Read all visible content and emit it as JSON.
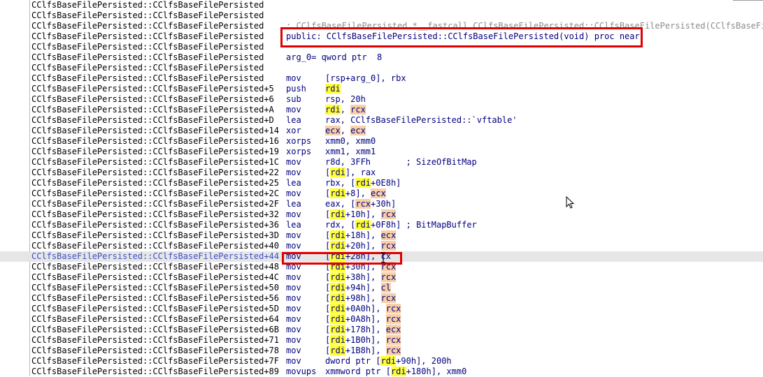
{
  "disassembly": {
    "rows": [
      {
        "addr": "CClfsBaseFilePersisted::CClfsBaseFilePersisted",
        "text": ""
      },
      {
        "addr": "CClfsBaseFilePersisted::CClfsBaseFilePersisted",
        "text": ""
      },
      {
        "addr": "CClfsBaseFilePersisted::CClfsBaseFilePersisted",
        "text": "; CClfsBaseFilePersisted *__fastcall CClfsBaseFilePersisted::CClfsBaseFilePersisted(CClfsBaseFileP",
        "kind": "proto"
      },
      {
        "addr": "CClfsBaseFilePersisted::CClfsBaseFilePersisted",
        "text": "public: CClfsBaseFilePersisted::CClfsBaseFilePersisted(void) proc near"
      },
      {
        "addr": "CClfsBaseFilePersisted::CClfsBaseFilePersisted",
        "text": ""
      },
      {
        "addr": "CClfsBaseFilePersisted::CClfsBaseFilePersisted",
        "text": "arg_0= qword ptr  8"
      },
      {
        "addr": "CClfsBaseFilePersisted::CClfsBaseFilePersisted",
        "text": ""
      },
      {
        "addr": "CClfsBaseFilePersisted::CClfsBaseFilePersisted",
        "mnem": "mov",
        "ops": [
          {
            "t": "[rsp+arg_0], rbx"
          }
        ]
      },
      {
        "addr": "CClfsBaseFilePersisted::CClfsBaseFilePersisted+5",
        "mnem": "push",
        "ops": [
          {
            "t": "rdi",
            "h": "y"
          }
        ]
      },
      {
        "addr": "CClfsBaseFilePersisted::CClfsBaseFilePersisted+6",
        "mnem": "sub",
        "ops": [
          {
            "t": "rsp, 20h"
          }
        ]
      },
      {
        "addr": "CClfsBaseFilePersisted::CClfsBaseFilePersisted+A",
        "mnem": "mov",
        "ops": [
          {
            "t": "rdi",
            "h": "y"
          },
          {
            "t": ", "
          },
          {
            "t": "rcx",
            "h": "o"
          }
        ]
      },
      {
        "addr": "CClfsBaseFilePersisted::CClfsBaseFilePersisted+D",
        "mnem": "lea",
        "ops": [
          {
            "t": "rax, CClfsBaseFilePersisted::`vftable'"
          }
        ]
      },
      {
        "addr": "CClfsBaseFilePersisted::CClfsBaseFilePersisted+14",
        "mnem": "xor",
        "ops": [
          {
            "t": "ecx",
            "h": "o"
          },
          {
            "t": ", "
          },
          {
            "t": "ecx",
            "h": "o"
          }
        ]
      },
      {
        "addr": "CClfsBaseFilePersisted::CClfsBaseFilePersisted+16",
        "mnem": "xorps",
        "ops": [
          {
            "t": "xmm0, xmm0"
          }
        ]
      },
      {
        "addr": "CClfsBaseFilePersisted::CClfsBaseFilePersisted+19",
        "mnem": "xorps",
        "ops": [
          {
            "t": "xmm1, xmm1"
          }
        ]
      },
      {
        "addr": "CClfsBaseFilePersisted::CClfsBaseFilePersisted+1C",
        "mnem": "mov",
        "ops": [
          {
            "t": "r8d, 3FFh       ; SizeOfBitMap"
          }
        ]
      },
      {
        "addr": "CClfsBaseFilePersisted::CClfsBaseFilePersisted+22",
        "mnem": "mov",
        "ops": [
          {
            "t": "["
          },
          {
            "t": "rdi",
            "h": "y"
          },
          {
            "t": "], rax"
          }
        ]
      },
      {
        "addr": "CClfsBaseFilePersisted::CClfsBaseFilePersisted+25",
        "mnem": "lea",
        "ops": [
          {
            "t": "rbx, ["
          },
          {
            "t": "rdi",
            "h": "y"
          },
          {
            "t": "+0E8h]"
          }
        ]
      },
      {
        "addr": "CClfsBaseFilePersisted::CClfsBaseFilePersisted+2C",
        "mnem": "mov",
        "ops": [
          {
            "t": "["
          },
          {
            "t": "rdi",
            "h": "y"
          },
          {
            "t": "+8], "
          },
          {
            "t": "ecx",
            "h": "o"
          }
        ]
      },
      {
        "addr": "CClfsBaseFilePersisted::CClfsBaseFilePersisted+2F",
        "mnem": "lea",
        "ops": [
          {
            "t": "eax, ["
          },
          {
            "t": "rcx",
            "h": "o"
          },
          {
            "t": "+30h]"
          }
        ]
      },
      {
        "addr": "CClfsBaseFilePersisted::CClfsBaseFilePersisted+32",
        "mnem": "mov",
        "ops": [
          {
            "t": "["
          },
          {
            "t": "rdi",
            "h": "y"
          },
          {
            "t": "+10h], "
          },
          {
            "t": "rcx",
            "h": "o"
          }
        ]
      },
      {
        "addr": "CClfsBaseFilePersisted::CClfsBaseFilePersisted+36",
        "mnem": "lea",
        "ops": [
          {
            "t": "rdx, ["
          },
          {
            "t": "rdi",
            "h": "y"
          },
          {
            "t": "+0F8h] ; BitMapBuffer"
          }
        ]
      },
      {
        "addr": "CClfsBaseFilePersisted::CClfsBaseFilePersisted+3D",
        "mnem": "mov",
        "ops": [
          {
            "t": "["
          },
          {
            "t": "rdi",
            "h": "y"
          },
          {
            "t": "+18h], "
          },
          {
            "t": "ecx",
            "h": "o"
          }
        ]
      },
      {
        "addr": "CClfsBaseFilePersisted::CClfsBaseFilePersisted+40",
        "mnem": "mov",
        "ops": [
          {
            "t": "["
          },
          {
            "t": "rdi",
            "h": "y"
          },
          {
            "t": "+20h], "
          },
          {
            "t": "rcx",
            "h": "o"
          }
        ]
      },
      {
        "addr": "CClfsBaseFilePersisted::CClfsBaseFilePersisted+44",
        "mnem": "mov",
        "ops": [
          {
            "t": "["
          },
          {
            "t": "rdi",
            "h": "y"
          },
          {
            "t": "+28h], cx"
          }
        ],
        "current": true
      },
      {
        "addr": "CClfsBaseFilePersisted::CClfsBaseFilePersisted+48",
        "mnem": "mov",
        "ops": [
          {
            "t": "["
          },
          {
            "t": "rdi",
            "h": "y"
          },
          {
            "t": "+30h], "
          },
          {
            "t": "rcx",
            "h": "o"
          }
        ]
      },
      {
        "addr": "CClfsBaseFilePersisted::CClfsBaseFilePersisted+4C",
        "mnem": "mov",
        "ops": [
          {
            "t": "["
          },
          {
            "t": "rdi",
            "h": "y"
          },
          {
            "t": "+38h], "
          },
          {
            "t": "rcx",
            "h": "o"
          }
        ]
      },
      {
        "addr": "CClfsBaseFilePersisted::CClfsBaseFilePersisted+50",
        "mnem": "mov",
        "ops": [
          {
            "t": "["
          },
          {
            "t": "rdi",
            "h": "y"
          },
          {
            "t": "+94h], "
          },
          {
            "t": "cl",
            "h": "o"
          }
        ]
      },
      {
        "addr": "CClfsBaseFilePersisted::CClfsBaseFilePersisted+56",
        "mnem": "mov",
        "ops": [
          {
            "t": "["
          },
          {
            "t": "rdi",
            "h": "y"
          },
          {
            "t": "+98h], "
          },
          {
            "t": "rcx",
            "h": "o"
          }
        ]
      },
      {
        "addr": "CClfsBaseFilePersisted::CClfsBaseFilePersisted+5D",
        "mnem": "mov",
        "ops": [
          {
            "t": "["
          },
          {
            "t": "rdi",
            "h": "y"
          },
          {
            "t": "+0A0h], "
          },
          {
            "t": "rcx",
            "h": "o"
          }
        ]
      },
      {
        "addr": "CClfsBaseFilePersisted::CClfsBaseFilePersisted+64",
        "mnem": "mov",
        "ops": [
          {
            "t": "["
          },
          {
            "t": "rdi",
            "h": "y"
          },
          {
            "t": "+0A8h], "
          },
          {
            "t": "rcx",
            "h": "o"
          }
        ]
      },
      {
        "addr": "CClfsBaseFilePersisted::CClfsBaseFilePersisted+6B",
        "mnem": "mov",
        "ops": [
          {
            "t": "["
          },
          {
            "t": "rdi",
            "h": "y"
          },
          {
            "t": "+178h], "
          },
          {
            "t": "ecx",
            "h": "o"
          }
        ]
      },
      {
        "addr": "CClfsBaseFilePersisted::CClfsBaseFilePersisted+71",
        "mnem": "mov",
        "ops": [
          {
            "t": "["
          },
          {
            "t": "rdi",
            "h": "y"
          },
          {
            "t": "+1B0h], "
          },
          {
            "t": "rcx",
            "h": "o"
          }
        ]
      },
      {
        "addr": "CClfsBaseFilePersisted::CClfsBaseFilePersisted+78",
        "mnem": "mov",
        "ops": [
          {
            "t": "["
          },
          {
            "t": "rdi",
            "h": "y"
          },
          {
            "t": "+1B8h], "
          },
          {
            "t": "rcx",
            "h": "o"
          }
        ]
      },
      {
        "addr": "CClfsBaseFilePersisted::CClfsBaseFilePersisted+7F",
        "mnem": "mov",
        "ops": [
          {
            "t": "dword ptr ["
          },
          {
            "t": "rdi",
            "h": "y"
          },
          {
            "t": "+90h], 200h"
          }
        ]
      },
      {
        "addr": "CClfsBaseFilePersisted::CClfsBaseFilePersisted+89",
        "mnem": "movups",
        "ops": [
          {
            "t": "xmmword ptr ["
          },
          {
            "t": "rdi",
            "h": "y"
          },
          {
            "t": "+180h], xmm0"
          }
        ]
      }
    ]
  },
  "colors": {
    "highlight_yellow": "#ffff33",
    "highlight_orange": "#f8cfa8",
    "annotation_red": "#e10000",
    "code_blue": "#00007f"
  }
}
